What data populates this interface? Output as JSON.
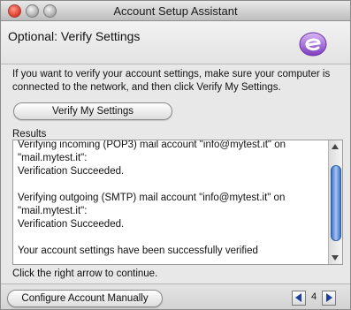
{
  "window": {
    "title": "Account Setup Assistant"
  },
  "header": {
    "title": "Optional: Verify Settings",
    "logo_icon": "entourage-e-logo"
  },
  "intro": "If you want to verify your account settings, make sure your computer is connected to the network, and then click Verify My Settings.",
  "verify_button": "Verify My Settings",
  "results": {
    "label": "Results",
    "lines": [
      "Verifying incoming (POP3) mail account \"info@mytest.it\" on",
      "\"mail.mytest.it\":",
      "Verification Succeeded.",
      "",
      "Verifying outgoing (SMTP) mail account \"info@mytest.it\" on",
      "\"mail.mytest.it\":",
      "Verification Succeeded.",
      "",
      "Your account settings have been successfully verified"
    ]
  },
  "continue_text": "Click the right arrow to continue.",
  "footer": {
    "manual_button": "Configure Account Manually",
    "step": "4"
  },
  "colors": {
    "accent": "#3e72c9",
    "logo_purple": "#8a4cc7"
  }
}
